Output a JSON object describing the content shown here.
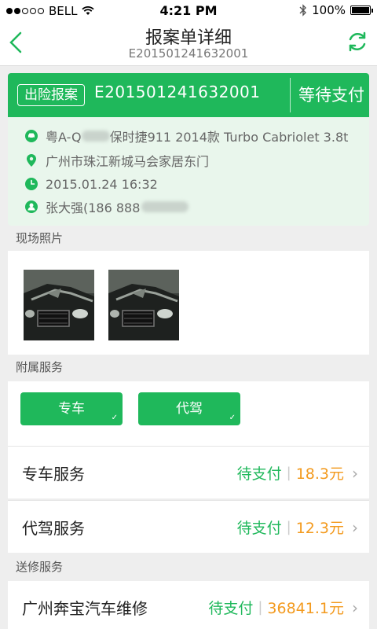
{
  "status_bar": {
    "carrier": "BELL",
    "time": "4:21 PM",
    "battery": "100%"
  },
  "header": {
    "title": "报案单详细",
    "subtitle": "E201501241632001"
  },
  "case": {
    "badge": "出险报案",
    "number": "E201501241632001",
    "status": "等待支付",
    "vehicle_prefix": "粤A-Q",
    "vehicle_model": "保时捷911 2014款 Turbo Cabriolet 3.8t",
    "address": "广州市珠江新城马会家居东门",
    "datetime": "2015.01.24 16:32",
    "contact": "张大强(186 888"
  },
  "photos": {
    "label": "现场照片",
    "items": [
      {
        "icon": "car-damage-photo"
      },
      {
        "icon": "car-damage-photo"
      }
    ]
  },
  "services": {
    "label": "附属服务",
    "buttons": [
      {
        "label": "专车",
        "check": "✓"
      },
      {
        "label": "代驾",
        "check": "✓"
      }
    ],
    "rows": [
      {
        "name": "专车服务",
        "status": "待支付",
        "sep": "|",
        "amount": "18.3元",
        "chevron": "›"
      },
      {
        "name": "代驾服务",
        "status": "待支付",
        "sep": "|",
        "amount": "12.3元",
        "chevron": "›"
      }
    ]
  },
  "repair": {
    "label": "送修服务",
    "rows": [
      {
        "name": "广州奔宝汽车维修",
        "status": "待支付",
        "sep": "|",
        "amount": "36841.1元",
        "chevron": "›"
      }
    ]
  },
  "colors": {
    "accent": "#1fb85b",
    "amount": "#f39a1e",
    "card_bg": "#e9f6ec"
  }
}
